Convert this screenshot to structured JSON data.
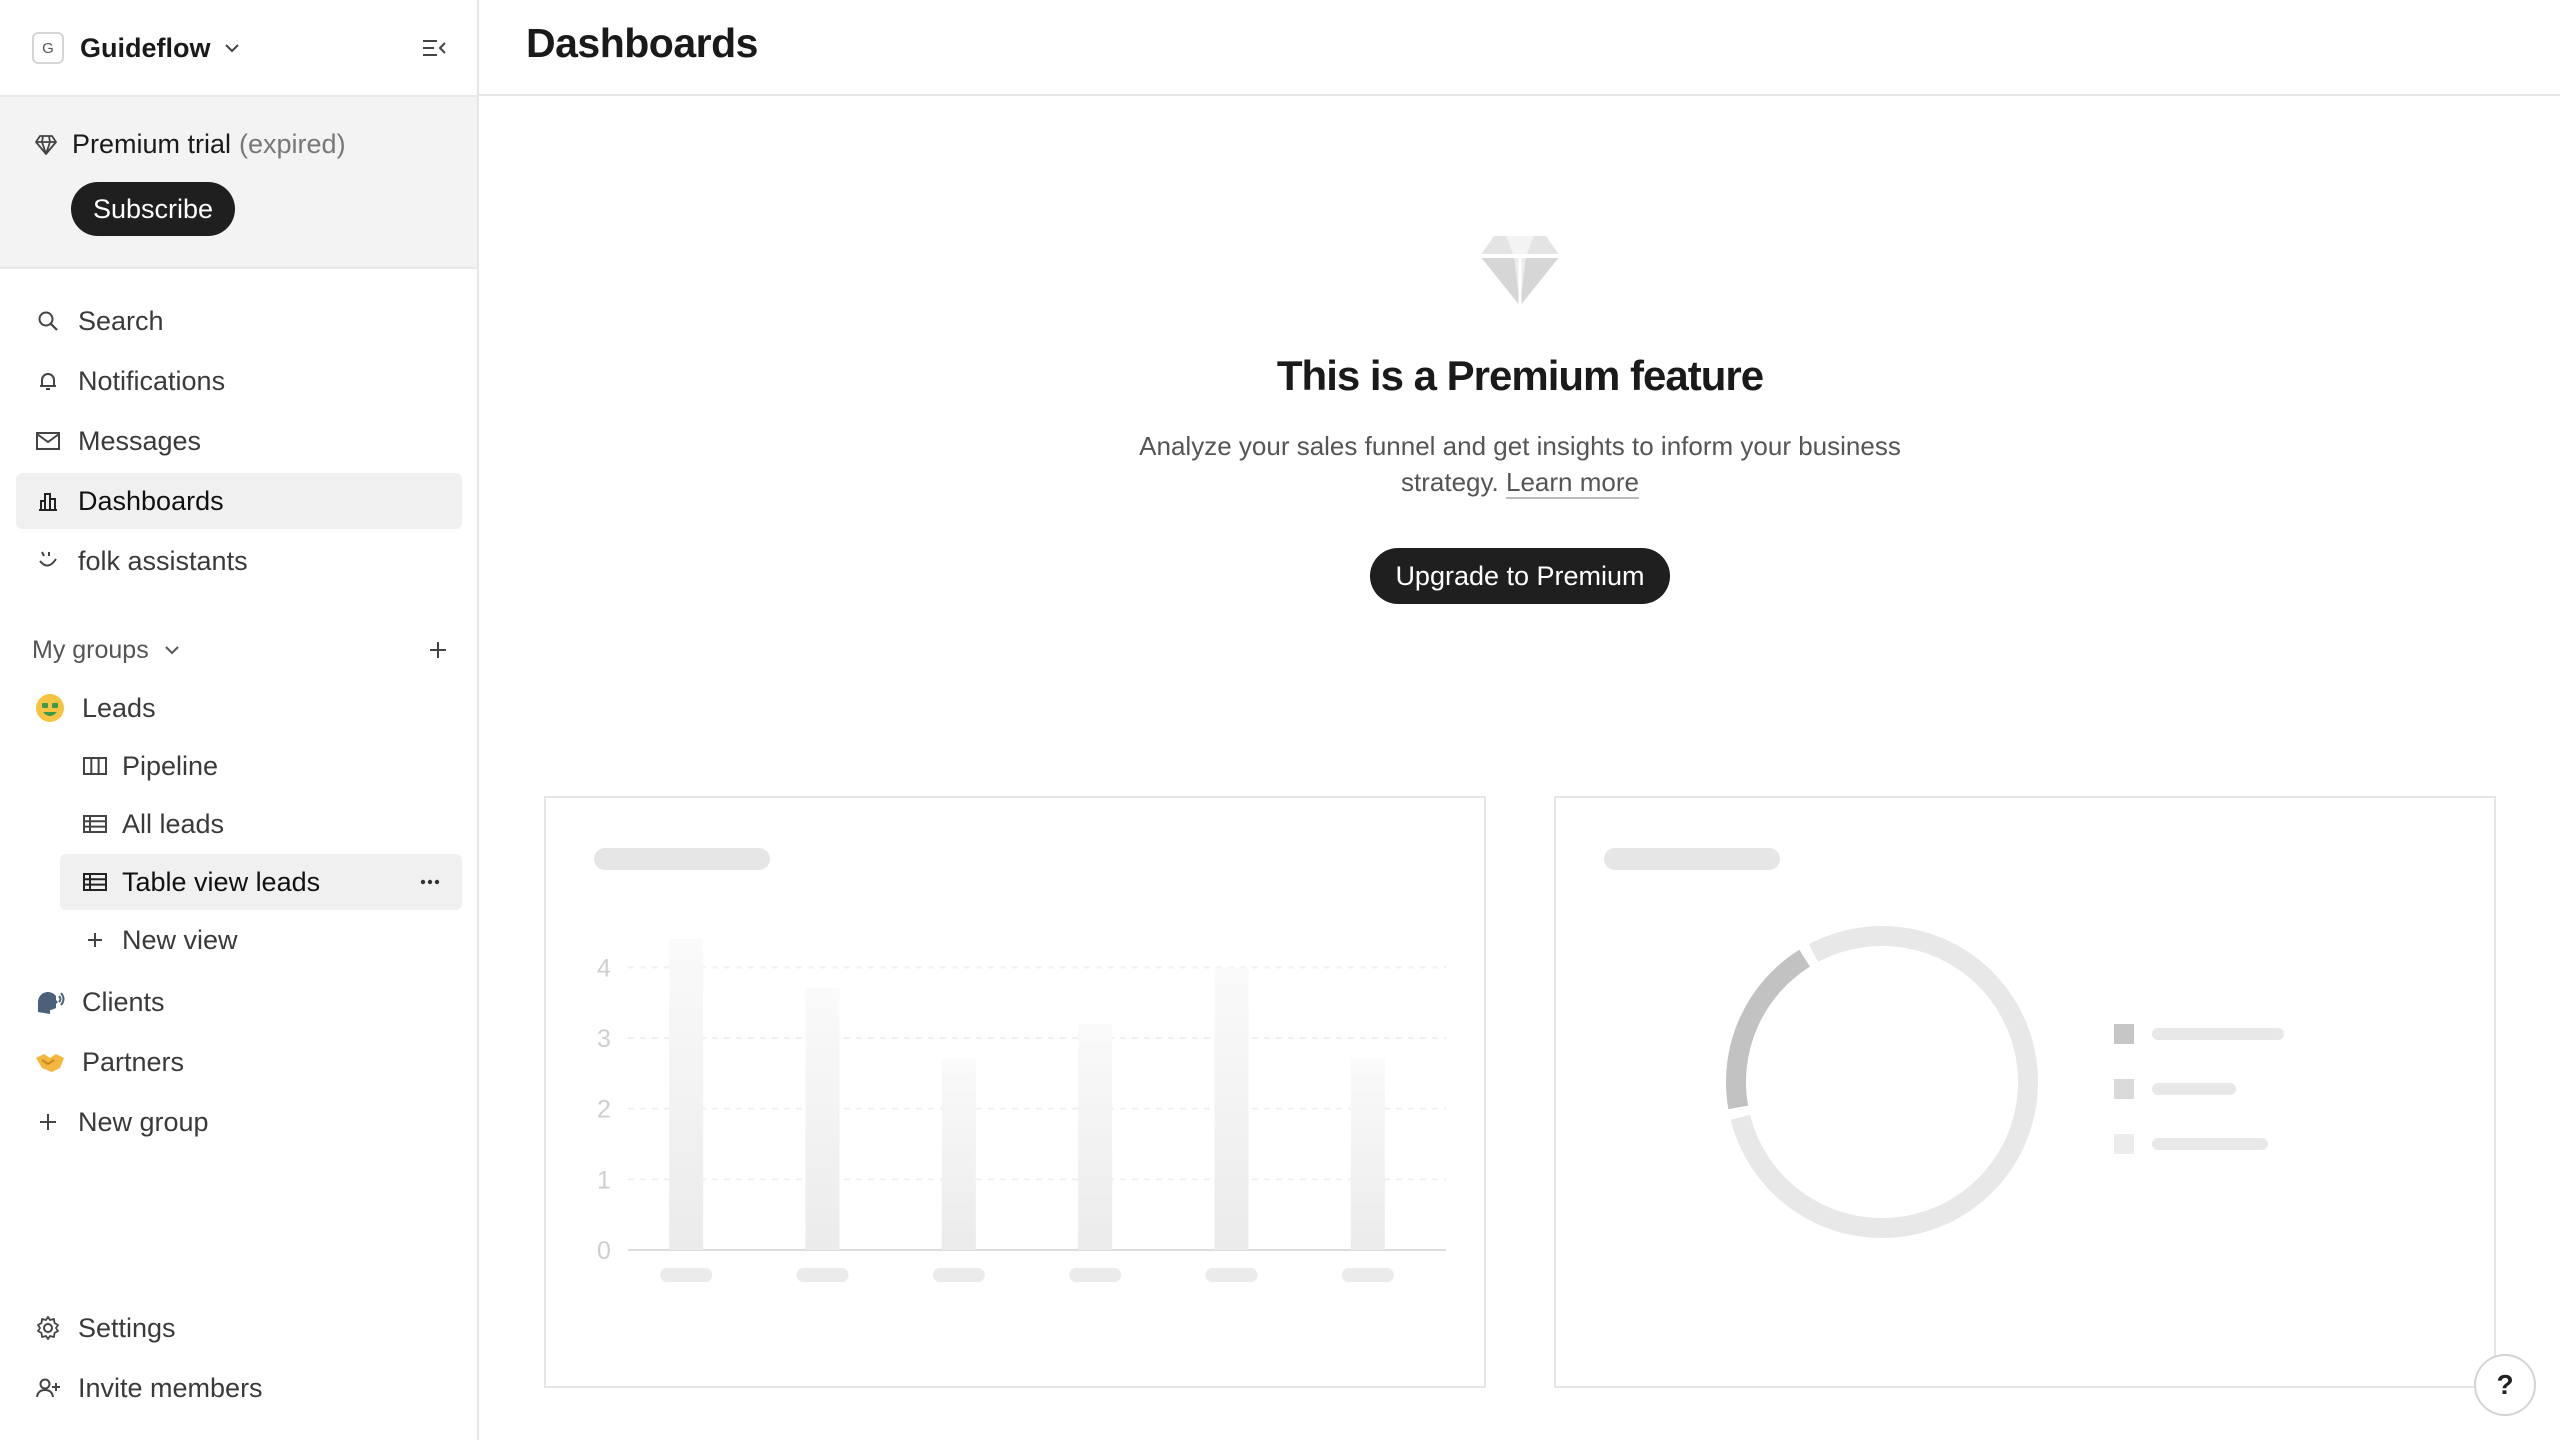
{
  "workspace": {
    "logo_letter": "G",
    "name": "Guideflow"
  },
  "trial": {
    "title": "Premium trial",
    "status": "(expired)",
    "subscribe_label": "Subscribe"
  },
  "nav": {
    "search": "Search",
    "notifications": "Notifications",
    "messages": "Messages",
    "dashboards": "Dashboards",
    "assistants": "folk assistants"
  },
  "groups": {
    "section_label": "My groups",
    "leads": {
      "label": "Leads",
      "views": {
        "pipeline": "Pipeline",
        "all_leads": "All leads",
        "table_view": "Table view leads",
        "new_view": "New view"
      }
    },
    "clients": "Clients",
    "partners": "Partners",
    "new_group": "New group"
  },
  "footer": {
    "settings": "Settings",
    "invite": "Invite members"
  },
  "main": {
    "title": "Dashboards",
    "promo_title": "This is a Premium feature",
    "promo_desc": "Analyze your sales funnel and get insights to inform your business strategy.",
    "learn_more": "Learn more",
    "upgrade_label": "Upgrade to Premium"
  },
  "help_label": "?",
  "chart_data": [
    {
      "type": "bar",
      "categories": [
        "",
        "",
        "",
        "",
        "",
        ""
      ],
      "values": [
        4.4,
        3.7,
        2.7,
        3.2,
        4.0,
        2.7
      ],
      "yticks": [
        "0",
        "1",
        "2",
        "3",
        "4"
      ],
      "ylim": [
        0,
        4.5
      ],
      "grid": true
    },
    {
      "type": "pie",
      "values": [
        20,
        80
      ],
      "legend_entries": 3,
      "colors": [
        "#c2c2c2",
        "#e8e8e8"
      ]
    }
  ],
  "colors": {
    "accent_dark": "#1f1f1f",
    "active_bg": "#f0f0f0"
  }
}
